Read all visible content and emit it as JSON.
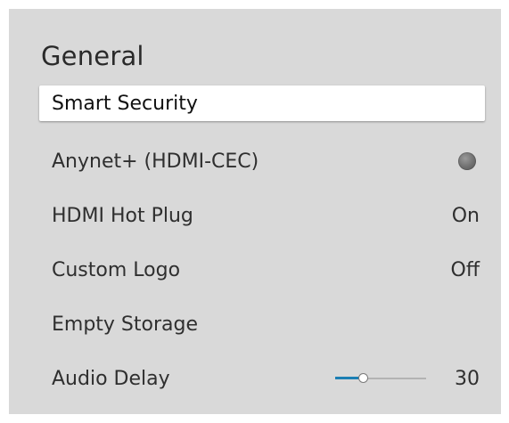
{
  "menu": {
    "title": "General",
    "items": [
      {
        "label": "Smart Security",
        "value": "",
        "focused": true
      },
      {
        "label": "Anynet+ (HDMI-CEC)",
        "value": "",
        "control": "toggle",
        "toggle_state": "off"
      },
      {
        "label": "HDMI Hot Plug",
        "value": "On"
      },
      {
        "label": "Custom Logo",
        "value": "Off"
      },
      {
        "label": "Empty Storage",
        "value": ""
      },
      {
        "label": "Audio Delay",
        "value": "30",
        "control": "slider",
        "slider_fraction": 0.3
      }
    ]
  },
  "colors": {
    "panel_background": "#d9d9d9",
    "focus_background": "#ffffff",
    "slider_accent": "#1c7fb3",
    "toggle_off": "#6f6f6f"
  }
}
